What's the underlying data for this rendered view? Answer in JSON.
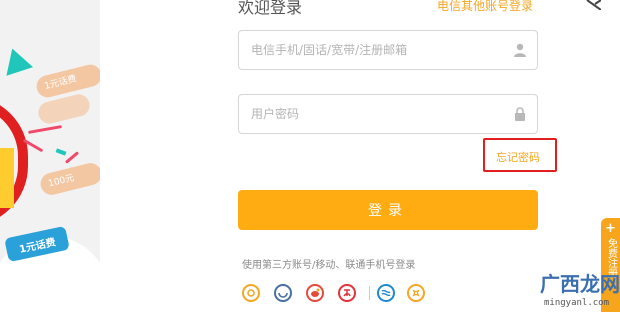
{
  "header": {
    "title": "欢迎登录",
    "other_account_link": "电信其他账号登录"
  },
  "promo": {
    "badge_text": "1元话费",
    "coupon_1": "1元话费",
    "coupon_2": "100元"
  },
  "form": {
    "username_placeholder": "电信手机/固话/宽带/注册邮箱",
    "password_placeholder": "用户密码",
    "forgot_label": "忘记密码",
    "login_label": "登录"
  },
  "third_party": {
    "text": "使用第三方账号/移动、联通手机号登录",
    "icons": [
      "wangwang-icon",
      "tianyi-icon",
      "weibo-icon",
      "alipay-icon",
      "china-mobile-icon",
      "china-unicom-icon"
    ]
  },
  "side_tab": {
    "plus": "+",
    "text": "免费注册"
  },
  "watermark": {
    "main": "广西龙网",
    "sub": "mingyanl.com"
  },
  "colors": {
    "accent": "#ffac13",
    "link": "#f5a623",
    "highlight_border": "#e21e1e"
  }
}
